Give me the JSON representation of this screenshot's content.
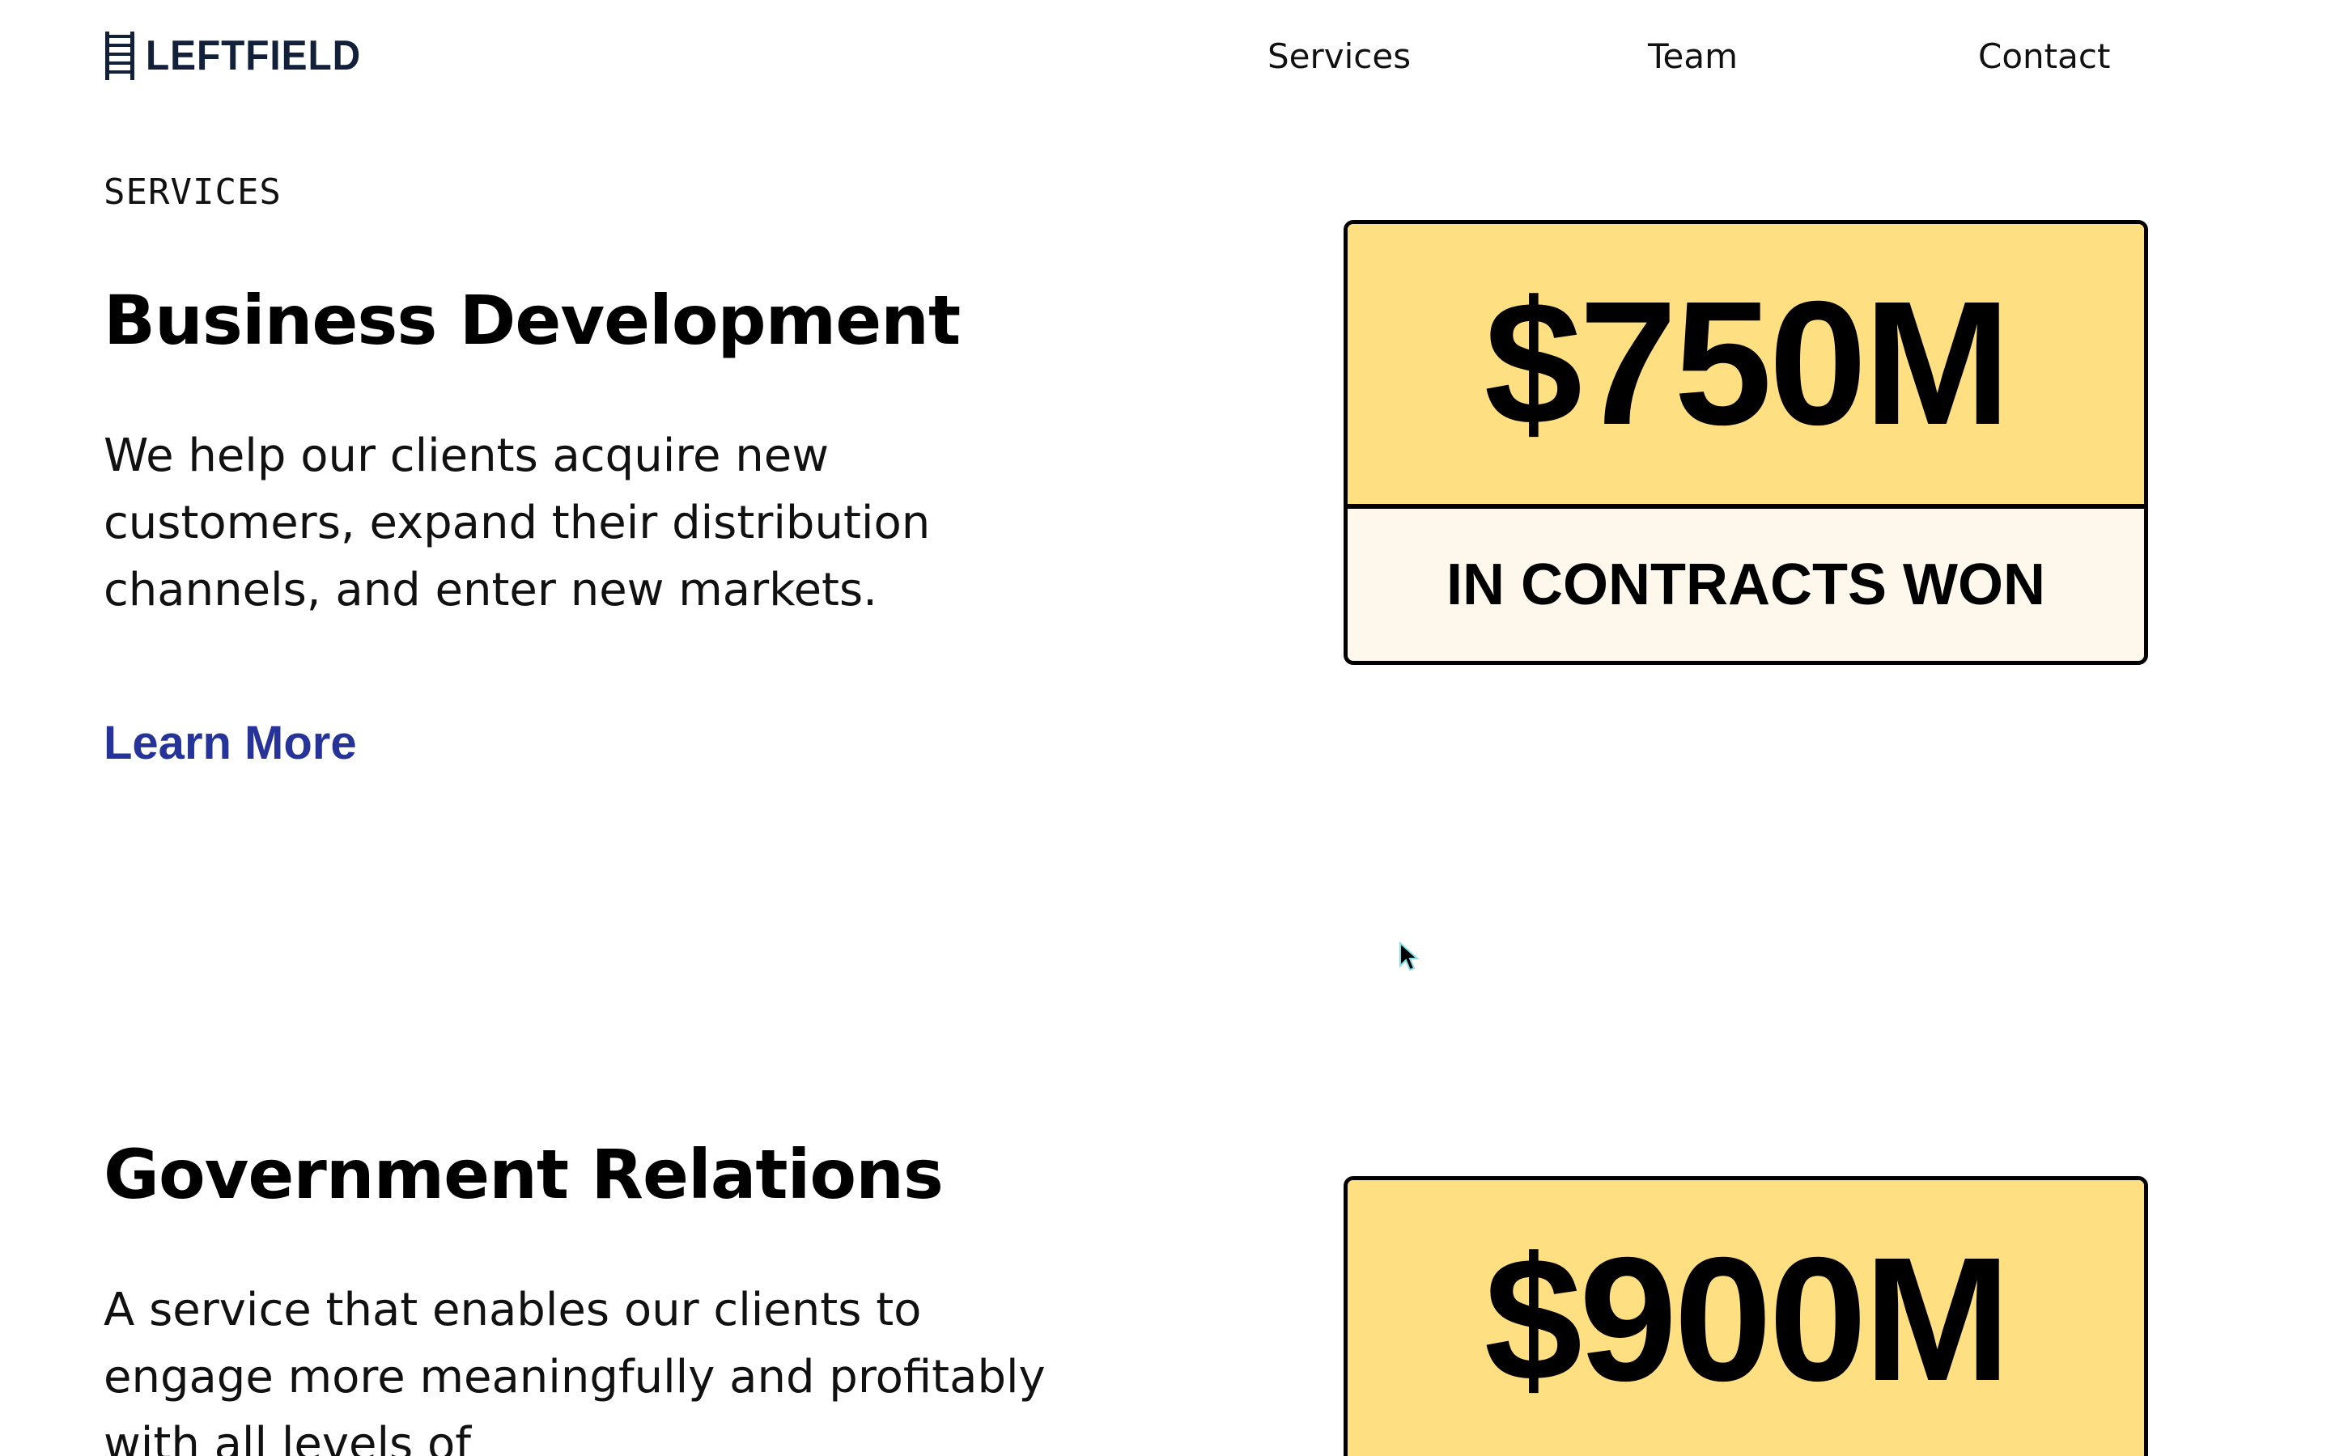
{
  "header": {
    "brand": "LEFTFIELD",
    "logo_icon": "ladder-icon",
    "nav": {
      "services": "Services",
      "team": "Team",
      "contact": "Contact"
    }
  },
  "services": {
    "eyebrow": "SERVICES",
    "items": [
      {
        "title": "Business Development",
        "description": "We help our clients acquire new customers, expand their distribution channels, and enter new markets.",
        "link_label": "Learn More",
        "stat_value": "$750M",
        "stat_label": "IN CONTRACTS WON"
      },
      {
        "title": "Government Relations",
        "description": "A service that enables our clients to engage more meaningfully and profitably with all levels of",
        "stat_value": "$900M"
      }
    ]
  },
  "colors": {
    "stat_highlight": "#fedf82",
    "stat_label_bg": "#fdf7ec",
    "link": "#26349a",
    "brand": "#13203a"
  }
}
